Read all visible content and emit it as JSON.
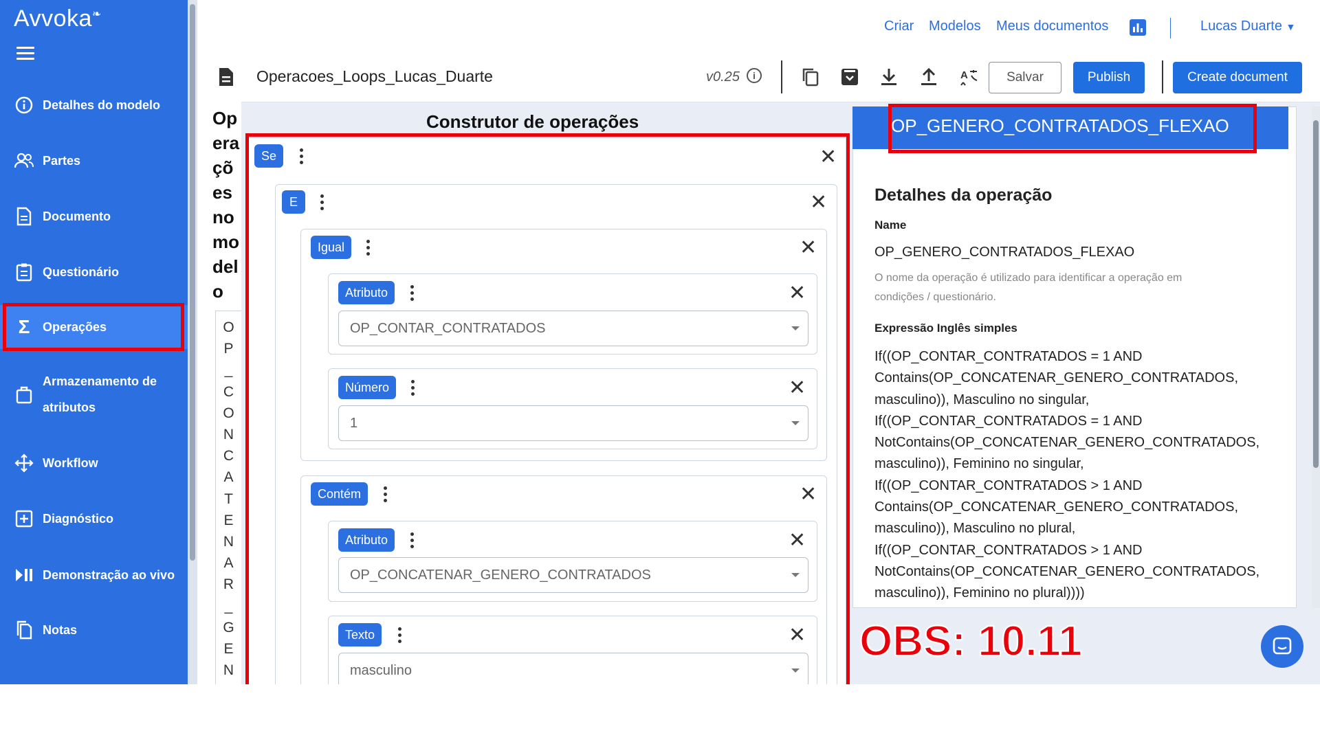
{
  "app": {
    "logo": "Avvoka"
  },
  "sidebar": {
    "items": [
      {
        "label": "Detalhes do modelo",
        "icon": "info-icon"
      },
      {
        "label": "Partes",
        "icon": "users-icon"
      },
      {
        "label": "Documento",
        "icon": "document-icon"
      },
      {
        "label": "Questionário",
        "icon": "clipboard-icon"
      },
      {
        "label": "Operações",
        "icon": "sigma-icon",
        "active": true
      },
      {
        "label_line1": "Armazenamento de",
        "label_line2": "atributos",
        "icon": "bag-icon"
      },
      {
        "label": "Workflow",
        "icon": "workflow-icon"
      },
      {
        "label": "Diagnóstico",
        "icon": "diagnostic-icon"
      },
      {
        "label": "Demonstração ao vivo",
        "icon": "play-pause-icon"
      },
      {
        "label": "Notas",
        "icon": "notes-icon"
      }
    ]
  },
  "topnav": {
    "criar": "Criar",
    "modelos": "Modelos",
    "meus_documentos": "Meus documentos",
    "user": "Lucas Duarte"
  },
  "toolbar": {
    "title": "Operacoes_Loops_Lucas_Duarte",
    "version": "v0.25",
    "save": "Salvar",
    "publish": "Publish",
    "create": "Create document"
  },
  "opcol": {
    "heading": "Operações no modelo",
    "heading_chars": [
      "Op",
      "era",
      "çõ",
      "es",
      "no",
      "mo",
      "del",
      "o"
    ],
    "item_chars": [
      "O",
      "P",
      "_",
      "C",
      "O",
      "N",
      "C",
      "A",
      "T",
      "E",
      "N",
      "A",
      "R",
      "_",
      "G",
      "E",
      "N"
    ]
  },
  "builder": {
    "title": "Construtor de operações",
    "se": "Se",
    "e": "E",
    "igual": "Igual",
    "atributo1": "Atributo",
    "atributo1_value": "OP_CONTAR_CONTRATADOS",
    "numero": "Número",
    "numero_value": "1",
    "contem": "Contém",
    "atributo2": "Atributo",
    "atributo2_value": "OP_CONCATENAR_GENERO_CONTRATADOS",
    "texto": "Texto",
    "texto_value": "masculino"
  },
  "details": {
    "header": "OP_GENERO_CONTRATADOS_FLEXAO",
    "title": "Detalhes da operação",
    "name_label": "Name",
    "name_value": "OP_GENERO_CONTRATADOS_FLEXAO",
    "hint_line1": "O nome da operação é utilizado para identificar a operação em",
    "hint_line2": "condições / questionário.",
    "expr_label": "Expressão Inglês simples",
    "expr_lines": [
      "If((OP_CONTAR_CONTRATADOS = 1 AND",
      "Contains(OP_CONCATENAR_GENERO_CONTRATADOS,",
      "masculino)), Masculino no singular,",
      "If((OP_CONTAR_CONTRATADOS = 1 AND",
      "NotContains(OP_CONCATENAR_GENERO_CONTRATADOS,",
      "masculino)), Feminino no singular,",
      "If((OP_CONTAR_CONTRATADOS > 1 AND",
      "Contains(OP_CONCATENAR_GENERO_CONTRATADOS,",
      "masculino)), Masculino no plural,",
      "If((OP_CONTAR_CONTRATADOS > 1 AND",
      "NotContains(OP_CONCATENAR_GENERO_CONTRATADOS,",
      "masculino)), Feminino no plural))))"
    ]
  },
  "annotation": {
    "obs": "OBS: 10.11"
  },
  "colors": {
    "brand": "#2b6fe0",
    "highlight": "#e8000b"
  }
}
